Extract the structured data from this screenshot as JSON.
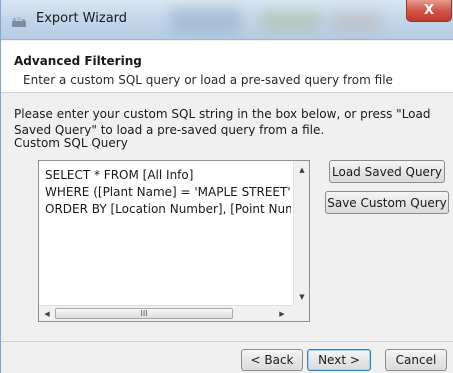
{
  "window": {
    "title": "Export Wizard",
    "close_label": "X"
  },
  "header": {
    "title": "Advanced Filtering",
    "subtitle": "Enter a custom SQL query or load a pre-saved query from file"
  },
  "body": {
    "instructions": "Please enter your custom SQL string in the box below, or press \"Load Saved Query\" to load a pre-saved query from a file.",
    "sql_label": "Custom SQL Query",
    "sql_text": "SELECT * FROM [All Info]\nWHERE ([Plant Name] = 'MAPLE STREET')\nORDER BY [Location Number], [Point Numl",
    "hscroll_grip": "III"
  },
  "buttons": {
    "load_saved_query": "Load Saved Query",
    "save_custom_query": "Save Custom Query",
    "back": "< Back",
    "next": "Next >",
    "cancel": "Cancel"
  },
  "icons": {
    "app": "export-wizard-icon",
    "close": "close-icon",
    "scroll_up": "chevron-up-icon",
    "scroll_down": "chevron-down-icon",
    "scroll_left": "chevron-left-icon",
    "scroll_right": "chevron-right-icon"
  },
  "colors": {
    "titlebar": "#c4d7ea",
    "close_button": "#c0392b",
    "dialog_bg": "#f0f0f0",
    "header_bg": "#ffffff"
  }
}
